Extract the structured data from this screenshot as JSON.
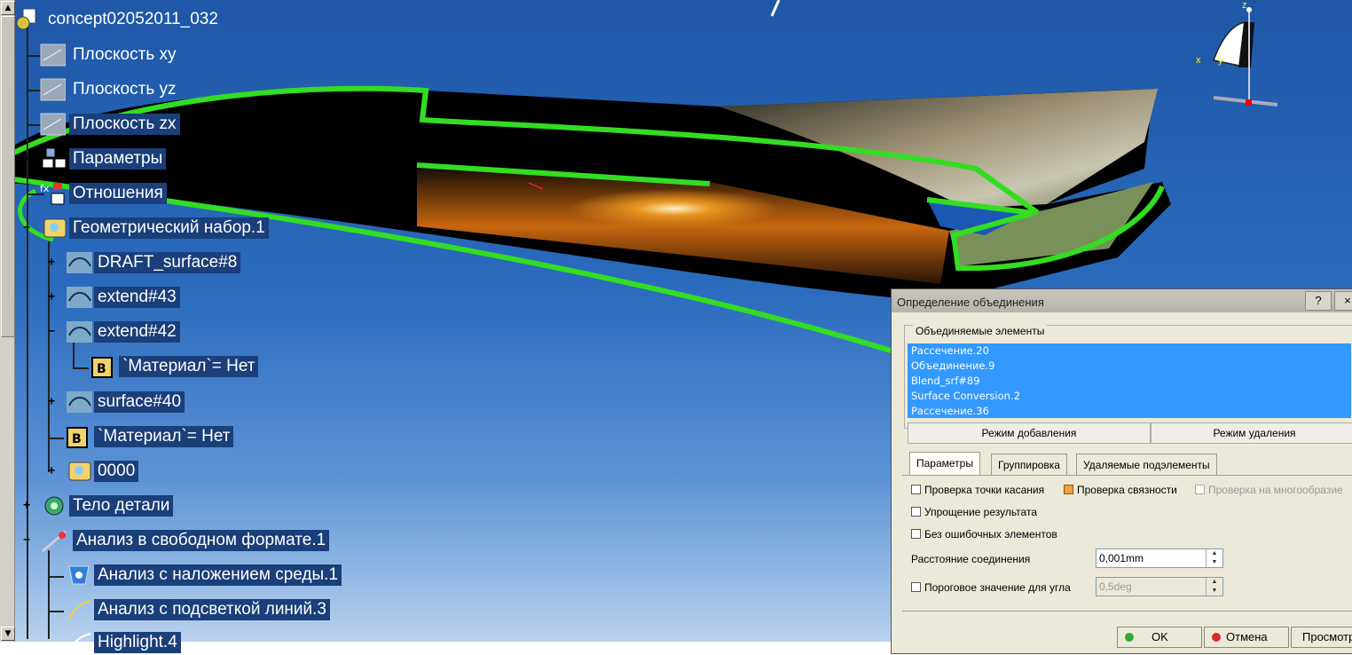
{
  "tree": {
    "items": [
      {
        "label": "concept02052011_032"
      },
      {
        "label": "Плоскость xy"
      },
      {
        "label": "Плоскость yz"
      },
      {
        "label": "Плоскость zx"
      },
      {
        "label": "Параметры"
      },
      {
        "label": "Отношения"
      },
      {
        "label": "Геометрический набор.1"
      },
      {
        "label": "DRAFT_surface#8"
      },
      {
        "label": "extend#43"
      },
      {
        "label": "extend#42"
      },
      {
        "label": "`Материал`= Нет"
      },
      {
        "label": "surface#40"
      },
      {
        "label": "`Материал`= Нет"
      },
      {
        "label": "0000"
      },
      {
        "label": "Тело детали"
      },
      {
        "label": "Анализ в свободном формате.1"
      },
      {
        "label": "Анализ с наложением среды.1"
      },
      {
        "label": "Анализ с подсветкой линий.3"
      },
      {
        "label": "Highlight.4"
      }
    ]
  },
  "compass": {
    "x": "x",
    "y": "y",
    "z": "z"
  },
  "dialog": {
    "title": "Определение объединения",
    "help_button": "?",
    "close_button": "×",
    "group_label": "Объединяемые элементы",
    "elements": [
      "Рассечение.20",
      "Объединение.9",
      "Blend_srf#89",
      "Surface Conversion.2",
      "Рассечение.36"
    ],
    "add_mode": "Режим добавления",
    "remove_mode": "Режим удаления",
    "tabs": [
      "Параметры",
      "Группировка",
      "Удаляемые подэлементы"
    ],
    "check_tangency": "Проверка точки касания",
    "check_connectivity": "Проверка связности",
    "check_manifold": "Проверка на многообразие",
    "simplify": "Упрощение результата",
    "no_errors": "Без ошибочных элементов",
    "merge_distance_label": "Расстояние соединения",
    "merge_distance_value": "0,001mm",
    "angle_label": "Пороговое значение для угла",
    "angle_value": "0,5deg",
    "ok": "OK",
    "cancel": "Отмена",
    "preview": "Просмотр"
  },
  "colors": {
    "selection": "#3399ff",
    "tree_highlight": "#1a3f7a",
    "edge_highlight": "#33dd22"
  }
}
